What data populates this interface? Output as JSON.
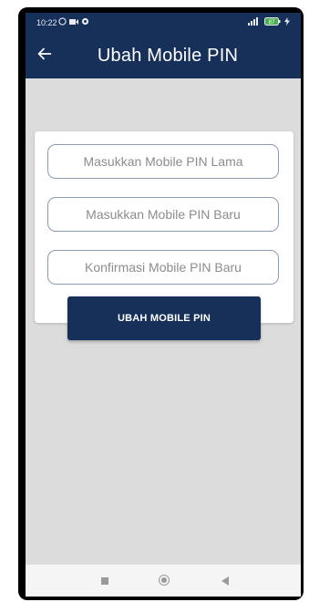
{
  "status": {
    "time": "10:22",
    "battery": "87"
  },
  "header": {
    "title": "Ubah Mobile PIN",
    "back_icon": "arrow-left-icon"
  },
  "form": {
    "old_pin_placeholder": "Masukkan Mobile PIN Lama",
    "new_pin_placeholder": "Masukkan Mobile PIN Baru",
    "confirm_pin_placeholder": "Konfirmasi Mobile PIN Baru",
    "old_pin_value": "",
    "new_pin_value": "",
    "confirm_pin_value": ""
  },
  "actions": {
    "submit_label": "UBAH MOBILE PIN"
  },
  "colors": {
    "primary": "#17305a",
    "background": "#dcdcdc",
    "card": "#ffffff"
  }
}
